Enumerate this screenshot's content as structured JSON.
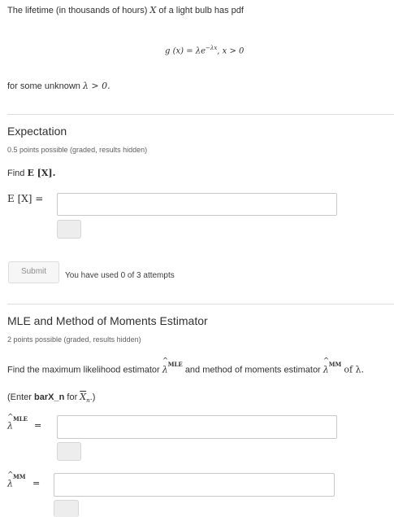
{
  "intro": {
    "line1": "The lifetime (in thousands of hours)",
    "var_x": "X",
    "line1_end": "of a light bulb has pdf",
    "formula_lhs": "g (x) = λe",
    "formula_exp": "−λx",
    "formula_cond": ",   x > 0",
    "line2": "for some unknown",
    "line2_math": "λ > 0."
  },
  "expectation": {
    "title": "Expectation",
    "points": "0.5 points possible (graded, results hidden)",
    "prompt_prefix": "Find",
    "prompt_math": "E [X].",
    "label": "E [X] =",
    "input_value": "",
    "submit_label": "Submit",
    "attempts": "You have used 0 of 3 attempts"
  },
  "mle": {
    "title": "MLE and Method of Moments Estimator",
    "points": "2 points possible (graded, results hidden)",
    "prompt_a": "Find the maximum likelihood estimator",
    "prompt_b": "and method of moments estimator",
    "prompt_c": "of λ.",
    "lambda": "λ",
    "sup_mle": "MLE",
    "sup_mm": "MM",
    "enter_prefix": "(Enter",
    "enter_bold": "barX_n",
    "enter_for": "for",
    "enter_math": "X",
    "enter_sub": "n",
    "enter_suffix": ".)",
    "equals": "=",
    "input_mle_value": "",
    "input_mm_value": ""
  }
}
